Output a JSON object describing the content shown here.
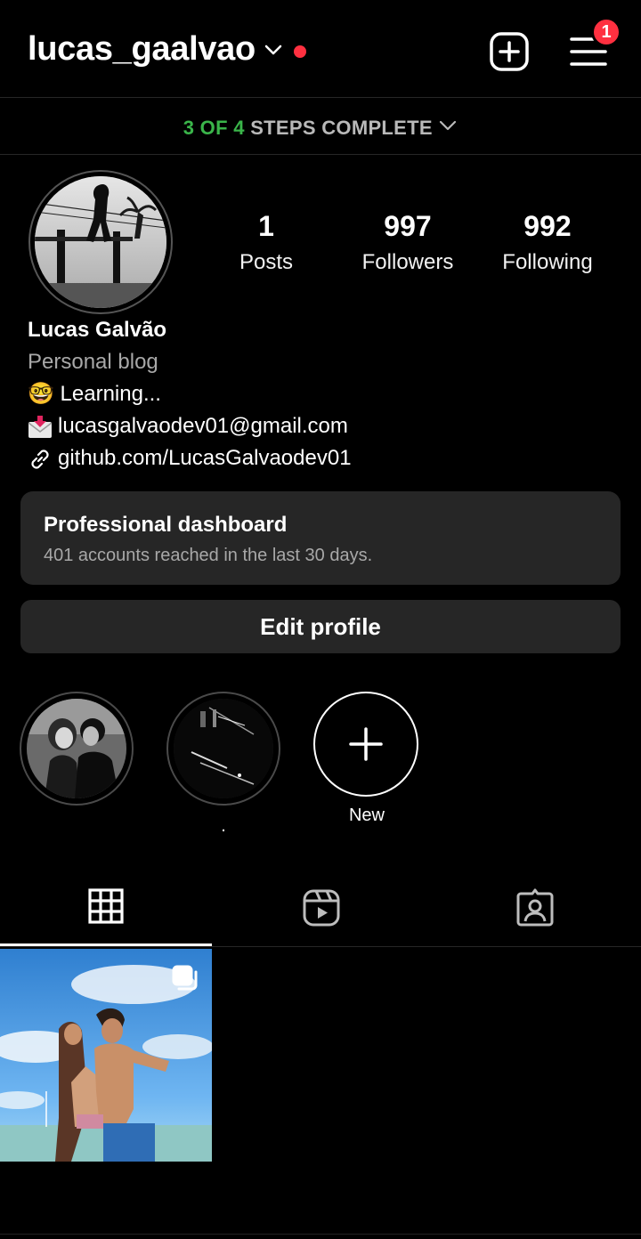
{
  "header": {
    "username": "lucas_gaalvao",
    "notification_count": "1"
  },
  "steps": {
    "progress": "3 OF 4",
    "label": "STEPS COMPLETE"
  },
  "stats": {
    "posts_count": "1",
    "posts_label": "Posts",
    "followers_count": "997",
    "followers_label": "Followers",
    "following_count": "992",
    "following_label": "Following"
  },
  "bio": {
    "display_name": "Lucas Galvão",
    "category": "Personal blog",
    "line1": "🤓 Learning...",
    "email": "lucasgalvaodev01@gmail.com",
    "link": "github.com/LucasGalvaodev01"
  },
  "dashboard": {
    "title": "Professional dashboard",
    "subtitle": "401 accounts reached in the last 30 days."
  },
  "edit_profile_label": "Edit profile",
  "highlights": [
    {
      "label": ""
    },
    {
      "label": "."
    },
    {
      "label": "New"
    }
  ],
  "colors": {
    "accent_red": "#ff3040",
    "steps_green": "#3ab54a",
    "card_bg": "#262626"
  }
}
